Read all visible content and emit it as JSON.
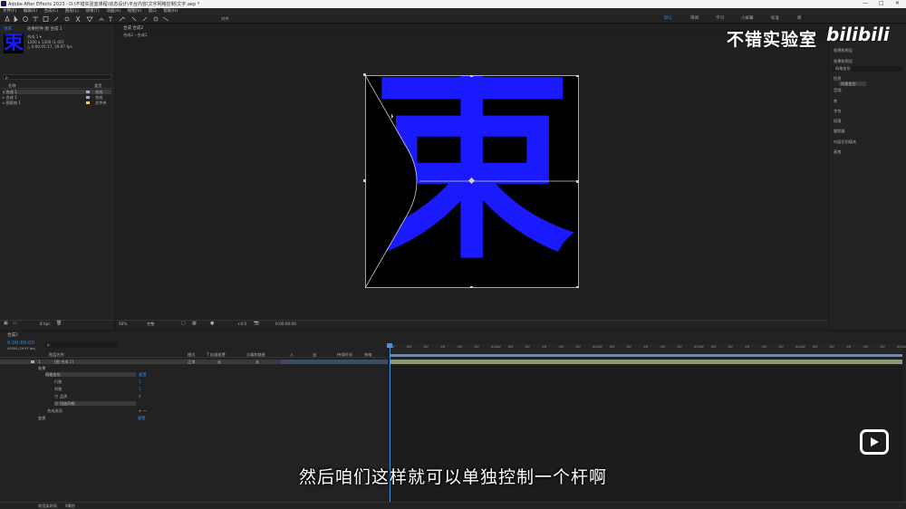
{
  "window": {
    "title": "Adobe After Effects 2023 - D:\\不错实验室课程\\动态设计\\平台内容\\文字网格控制\\文字.aep *",
    "controls": [
      "—",
      "□",
      "✕"
    ]
  },
  "menu": [
    "文件(F)",
    "编辑(E)",
    "合成(C)",
    "图层(L)",
    "效果(T)",
    "动画(A)",
    "视图(V)",
    "窗口",
    "帮助(H)"
  ],
  "workspaces": [
    "默认",
    "审阅",
    "学习",
    "小屏幕",
    "标准",
    "库"
  ],
  "toolbar": {
    "snap_label": "对齐"
  },
  "project_panel": {
    "tabs": [
      "项目",
      "效果控件 图 合成 1"
    ],
    "thumb_glyph": "束",
    "info_name": "合成 1 ▾",
    "info_size": "1200 x 1200 (1.00)",
    "info_duration": "△ 0:00:05:17, 29.97 fps",
    "search_placeholder": "ρ",
    "col_name": "名称",
    "col_type": "类型",
    "items": [
      {
        "name": "合成 1",
        "type": "合成",
        "color": "#b4a0c8"
      },
      {
        "name": "合成 1",
        "type": "合成",
        "color": "#b4a0c8"
      },
      {
        "name": "图表效 1",
        "type": "文件夹",
        "color": "#e8d35a"
      }
    ],
    "bpc": "8 bpc"
  },
  "comp_panel": {
    "tab": "合成 合成2",
    "breadcrumb": "合成2  ‹ 合成1",
    "glyph": "束",
    "zoom": "50%",
    "quality": "完整",
    "exposure": "+0.0",
    "timecode": "0:00:00:00"
  },
  "right_panel": {
    "workspace_title": "效果和预设",
    "items": [
      "效果和预设",
      "网格变形",
      "信息",
      "音频",
      "库",
      "字符",
      "段落",
      "跟踪器",
      "内容识别填充",
      "画笔"
    ],
    "effect_row": "网格变形"
  },
  "timeline": {
    "tab": "合成2",
    "timecode": "0:00:00:00",
    "sub_timecode": "00000 (29.97 fps)",
    "search_placeholder": "ρ.",
    "col_layer_name": "图层名称",
    "col_mode": "模式",
    "col_trkmat": "T  轨道遮罩",
    "col_parent": "父级和链接",
    "col_in": "入",
    "col_out": "出",
    "col_duration": "持续时间",
    "col_stretch": "伸缩",
    "layers": [
      {
        "num": "1",
        "name": "[图 合成 1]",
        "mode": "正常",
        "trkmat": "无",
        "parent": "无"
      },
      {
        "num": "",
        "name": "效果",
        "mode": "",
        "trkmat": "",
        "parent": ""
      },
      {
        "num": "",
        "name": "网格变形",
        "mode": "重置",
        "trkmat": "",
        "parent": ""
      },
      {
        "num": "",
        "name": "行数",
        "mode": "1",
        "trkmat": "",
        "parent": ""
      },
      {
        "num": "",
        "name": "列数",
        "mode": "1",
        "trkmat": "",
        "parent": ""
      },
      {
        "num": "",
        "name": "品质",
        "mode": "8",
        "trkmat": "",
        "parent": ""
      },
      {
        "num": "",
        "name": "扭曲网格",
        "mode": "",
        "trkmat": "",
        "parent": ""
      },
      {
        "num": "",
        "name": "合成选项",
        "mode": "+ —",
        "trkmat": "",
        "parent": ""
      },
      {
        "num": "",
        "name": "变换",
        "mode": "重置",
        "trkmat": "",
        "parent": ""
      }
    ],
    "ruler_ticks": [
      "00f",
      "05f",
      "10f",
      "15f",
      "20f",
      "25f",
      "01:00f",
      "05f",
      "10f",
      "15f",
      "20f",
      "25f",
      "02:00f",
      "05f",
      "10f",
      "15f",
      "20f",
      "25f",
      "03:00f",
      "05f",
      "10f",
      "15f",
      "20f",
      "25f",
      "04:00f",
      "05f",
      "10f",
      "15f",
      "20f",
      "25f",
      "05:00f"
    ],
    "footer_left": "帧渲染时间",
    "footer_ms": "0毫秒"
  },
  "overlay": {
    "subtitle": "然后咱们这样就可以单独控制一个杆啊",
    "watermark": "不错实验室",
    "bili_logo": "bilibili"
  },
  "colors": {
    "accent": "#2d8ceb",
    "glyph": "#1a1aff",
    "panel": "#232323"
  }
}
